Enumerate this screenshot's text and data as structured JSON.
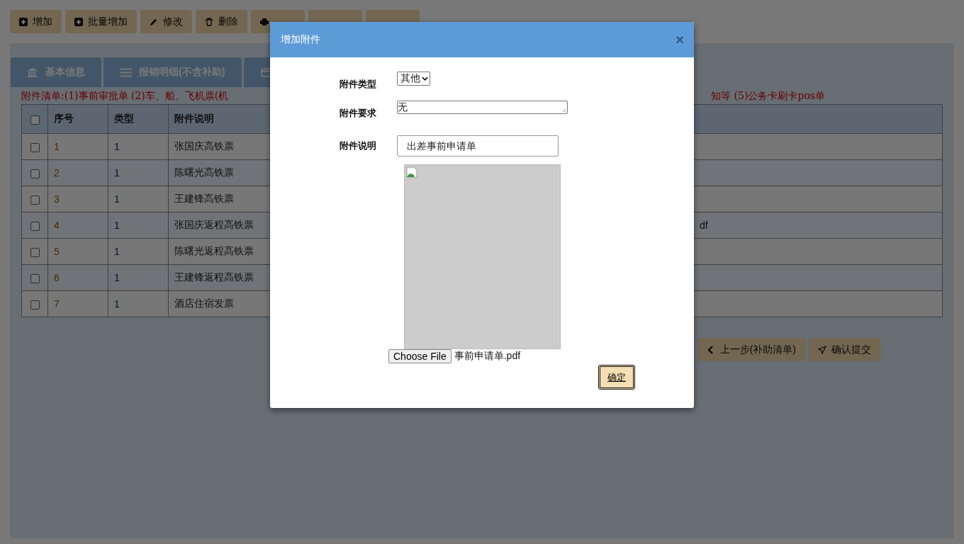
{
  "toolbar": [
    {
      "label": "增加"
    },
    {
      "label": "批量增加"
    },
    {
      "label": "修改"
    },
    {
      "label": "删除"
    }
  ],
  "tabs": [
    {
      "label": "基本信息",
      "selected": false
    },
    {
      "label": "报销明细(不含补助)",
      "selected": false
    },
    {
      "selected": false
    }
  ],
  "notice": {
    "start": "附件清单:(1)事前审批单 (2)车、船、飞机票(机",
    "end": "知等 (5)公务卡刷卡pos单"
  },
  "table": {
    "header_checked": false,
    "columns": [
      "序号",
      "类型",
      "附件说明"
    ],
    "rows": [
      {
        "checked": false,
        "cells": [
          "1",
          "1",
          "张国庆高铁票"
        ]
      },
      {
        "checked": false,
        "cells": [
          "2",
          "1",
          "陈曙光高铁票"
        ]
      },
      {
        "checked": false,
        "cells": [
          "3",
          "1",
          "王建锋高铁票"
        ]
      },
      {
        "checked": false,
        "cells": [
          "4",
          "1",
          "张国庆返程高铁票"
        ],
        "column_5": "df"
      },
      {
        "checked": false,
        "cells": [
          "5",
          "1",
          "陈曙光返程高铁票"
        ]
      },
      {
        "checked": false,
        "cells": [
          "6",
          "1",
          "王建锋返程高铁票"
        ]
      },
      {
        "checked": false,
        "cells": [
          "7",
          "1",
          "酒店住宿发票"
        ]
      }
    ]
  },
  "bottom_buttons": [
    {
      "label": "上一步(补助清单)"
    },
    {
      "label": "确认提交"
    }
  ],
  "dialog": {
    "title": "增加附件",
    "close": "×",
    "fields": [
      {
        "label": "附件类型",
        "kind": "select",
        "value": "其他"
      },
      {
        "label": "附件要求",
        "kind": "textarea",
        "value": "无"
      },
      {
        "label": "附件说明",
        "kind": "input",
        "value": "出差事前申请单"
      }
    ],
    "file_button": "Choose File",
    "file_name": "事前申请单.pdf",
    "confirm": "确定"
  }
}
